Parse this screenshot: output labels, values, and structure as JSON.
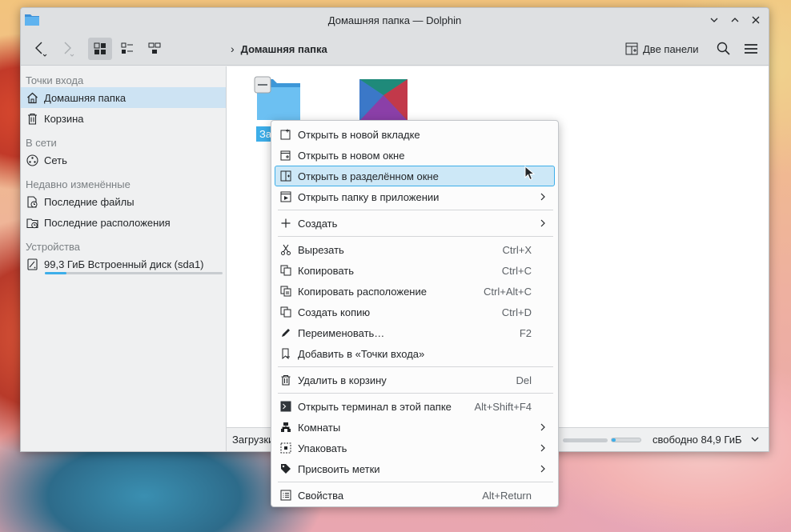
{
  "window": {
    "title": "Домашняя папка — Dolphin"
  },
  "toolbar": {
    "breadcrumb": "Домашняя папка",
    "two_panels": "Две панели"
  },
  "sidebar": {
    "sections": {
      "places": "Точки входа",
      "network": "В сети",
      "recent": "Недавно изменённые",
      "devices": "Устройства"
    },
    "items": {
      "home": "Домашняя папка",
      "trash": "Корзина",
      "network": "Сеть",
      "recent_files": "Последние файлы",
      "recent_locations": "Последние расположения",
      "disk": "99,3 ГиБ Встроенный диск (sda1)"
    },
    "disk_usage_fraction": 0.12
  },
  "content": {
    "selected_folder_label": "Заг"
  },
  "statusbar": {
    "text": "Загрузки",
    "free_space": "свободно 84,9 ГиБ",
    "space_used_fraction": 0.15
  },
  "context_menu": {
    "open_new_tab": "Открыть в новой вкладке",
    "open_new_window": "Открыть в новом окне",
    "open_split": "Открыть в разделённом окне",
    "open_in_app": "Открыть папку в приложении",
    "create": "Создать",
    "cut": "Вырезать",
    "cut_shortcut": "Ctrl+X",
    "copy": "Копировать",
    "copy_shortcut": "Ctrl+C",
    "copy_location": "Копировать расположение",
    "copy_location_shortcut": "Ctrl+Alt+C",
    "duplicate": "Создать копию",
    "duplicate_shortcut": "Ctrl+D",
    "rename": "Переименовать…",
    "rename_shortcut": "F2",
    "add_to_places": "Добавить в «Точки входа»",
    "trash": "Удалить в корзину",
    "trash_shortcut": "Del",
    "terminal": "Открыть терминал в этой папке",
    "terminal_shortcut": "Alt+Shift+F4",
    "activities": "Комнаты",
    "compress": "Упаковать",
    "tags": "Присвоить метки",
    "properties": "Свойства",
    "properties_shortcut": "Alt+Return"
  },
  "colors": {
    "accent": "#3daee9",
    "highlight": "#cde8f7",
    "sidebar_selected": "#cde3f3"
  }
}
